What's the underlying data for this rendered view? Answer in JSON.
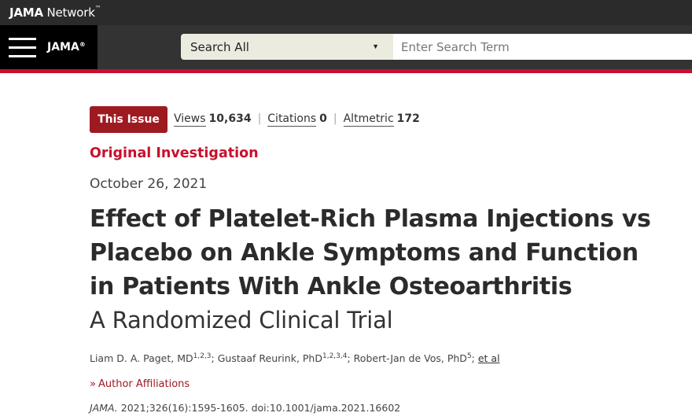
{
  "network_bar": {
    "brand_bold": "JAMA",
    "brand_rest": " Network",
    "trademark": "™"
  },
  "header": {
    "journal_logo": "JAMA",
    "journal_reg": "®",
    "search_scope": "Search All",
    "search_placeholder": "Enter Search Term"
  },
  "colors": {
    "accent": "#c8102e",
    "issue_badge": "#9e1a21",
    "header_bg": "#333333",
    "network_bg": "#2b2b2b"
  },
  "article": {
    "badge": "This Issue",
    "metrics": [
      {
        "label": "Views",
        "value": "10,634"
      },
      {
        "label": "Citations",
        "value": "0"
      },
      {
        "label": "Altmetric",
        "value": "172"
      }
    ],
    "type": "Original Investigation",
    "date": "October 26, 2021",
    "title": "Effect of Platelet-Rich Plasma Injections vs Placebo on Ankle Symptoms and Function in Patients With Ankle Osteoarthritis",
    "subtitle": "A Randomized Clinical Trial",
    "authors": [
      {
        "name": "Liam D. A. Paget, MD",
        "sup": "1,2,3",
        "after": "; "
      },
      {
        "name": "Gustaaf Reurink, PhD",
        "sup": "1,2,3,4",
        "after": "; "
      },
      {
        "name": "Robert-Jan de Vos, PhD",
        "sup": "5",
        "after": "; "
      }
    ],
    "et_al": "et al",
    "affiliations_label": "Author Affiliations",
    "citation_journal": "JAMA.",
    "citation_text": " 2021;326(16):1595-1605. doi:10.1001/jama.2021.16602"
  }
}
